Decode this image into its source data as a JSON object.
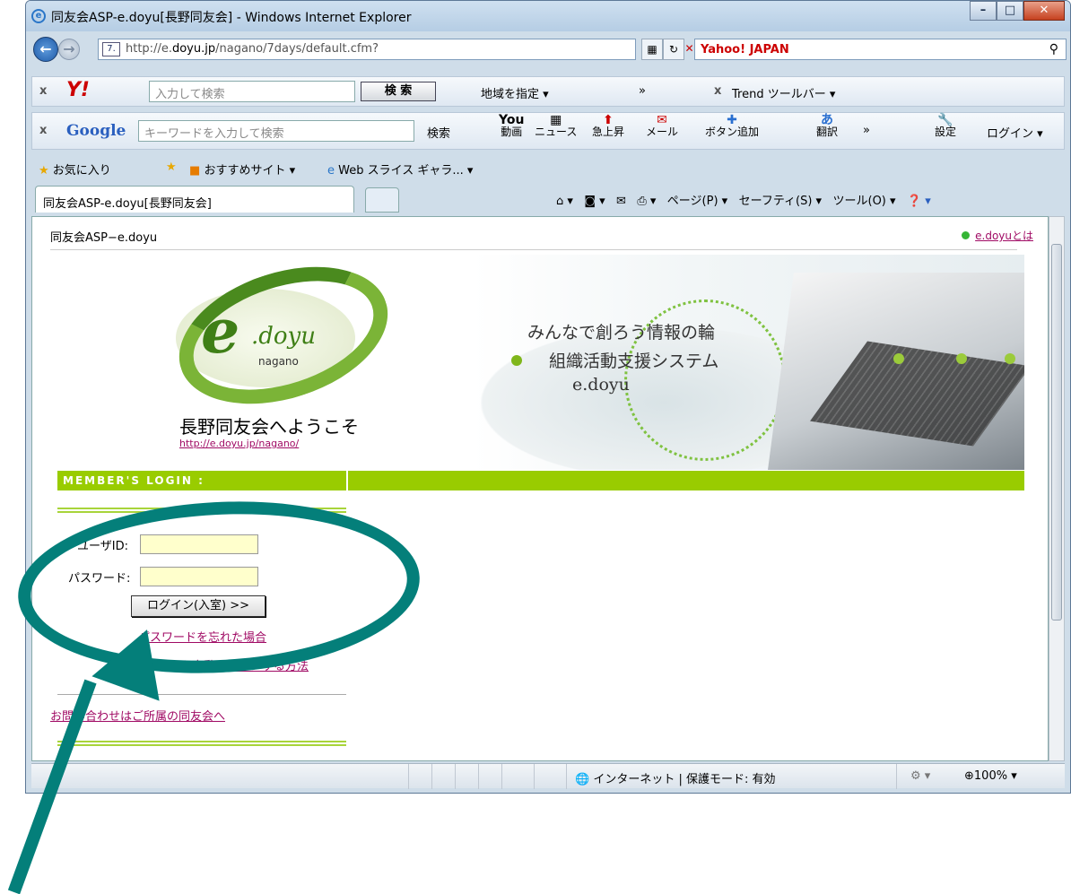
{
  "window": {
    "title": "同友会ASP-e.doyu[長野同友会] - Windows Internet Explorer",
    "icon": "ie-icon"
  },
  "nav": {
    "url_prefix": "http://e.",
    "url_domain": "doyu.jp",
    "url_path": "/nagano/7days/default.cfm?",
    "search_provider": "Yahoo! JAPAN"
  },
  "yahoo_toolbar": {
    "search_placeholder": "入力して検索",
    "search_button": "検 索",
    "region": "地域を指定 ▾",
    "more": "»",
    "trend": "Trend ツールバー ▾"
  },
  "google_toolbar": {
    "search_placeholder": "キーワードを入力して検索",
    "search_label": "検索",
    "items": [
      {
        "line1": "You",
        "line2": "動画"
      },
      {
        "line1": "▦",
        "line2": "ニュース"
      },
      {
        "line1": "⬆",
        "line2": "急上昇"
      },
      {
        "line1": "✉",
        "line2": "メール"
      },
      {
        "line1": "✚",
        "line2": "ボタン追加"
      },
      {
        "line1": "あ",
        "line2": "翻訳"
      },
      {
        "line1": "🔧",
        "line2": "設定"
      }
    ],
    "more": "»",
    "login": "ログイン ▾"
  },
  "favorites": {
    "label": "お気に入り",
    "recommended": "おすすめサイト ▾",
    "webslice": "Web スライス ギャラ... ▾"
  },
  "tabs": {
    "active": "同友会ASP-e.doyu[長野同友会]"
  },
  "commandbar": {
    "page": "ページ(P) ▾",
    "safety": "セーフティ(S) ▾",
    "tools": "ツール(O) ▾"
  },
  "page": {
    "site_name": "同友会ASP−e.doyu",
    "about_link": "e.doyuとは",
    "logo": {
      "e": "e",
      "doyu": ".doyu",
      "sub": "nagano"
    },
    "welcome": "長野同友会へようこそ",
    "welcome_url": "http://e.doyu.jp/nagano/",
    "hero": {
      "line1": "みんなで創ろう情報の輪",
      "line2": "組織活動支援システム",
      "line3": "e.doyu"
    },
    "login_bar": "MEMBER'S LOGIN :",
    "user_id_label": "ユーザID:",
    "password_label": "パスワード:",
    "login_button": "ログイン(入室) >>",
    "forgot_link": "パスワードを忘れた場合",
    "howto_link": "…を自動ログインする方法",
    "contact_link": "お問い合わせはご所属の同友会へ"
  },
  "status": {
    "zone": "インターネット | 保護モード: 有効",
    "zoom": "100%"
  },
  "annotation": {
    "color": "#047f7a"
  }
}
